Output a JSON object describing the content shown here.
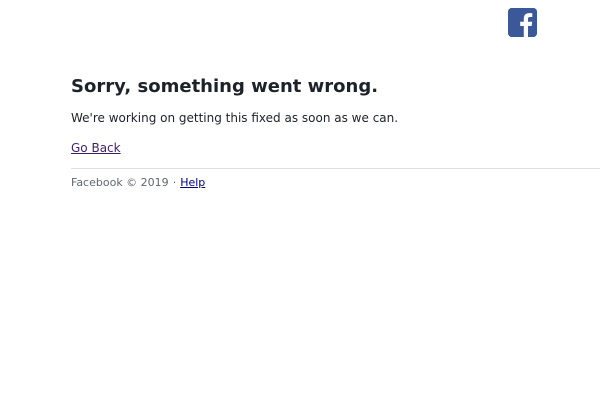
{
  "header": {
    "logo_icon": "facebook-f-icon",
    "logo_color": "#3b5998"
  },
  "error": {
    "title": "Sorry, something went wrong.",
    "message": "We're working on getting this fixed as soon as we can.",
    "go_back_label": "Go Back"
  },
  "footer": {
    "copyright": "Facebook © 2019",
    "separator": "·",
    "help_label": "Help"
  },
  "colors": {
    "text": "#1d2129",
    "muted": "#606770",
    "visited_link": "#3f1f6b",
    "link": "#000080",
    "divider": "#dddfe2"
  }
}
